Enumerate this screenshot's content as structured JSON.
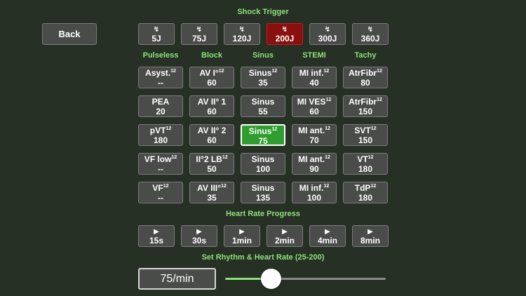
{
  "back_label": "Back",
  "shock": {
    "title": "Shock Trigger",
    "glyph": "↯",
    "buttons": [
      "5J",
      "75J",
      "120J",
      "200J",
      "300J",
      "360J"
    ],
    "active_index": 3
  },
  "columns": [
    "Pulseless",
    "Block",
    "Sinus",
    "STEMI",
    "Tachy"
  ],
  "rhythms": [
    [
      {
        "name": "Asyst.",
        "sup": "12",
        "rate": "--"
      },
      {
        "name": "PEA",
        "sup": "",
        "rate": "20"
      },
      {
        "name": "pVT",
        "sup": "12",
        "rate": "180"
      },
      {
        "name": "VF low",
        "sup": "12",
        "rate": "--"
      },
      {
        "name": "VF",
        "sup": "12",
        "rate": "--"
      }
    ],
    [
      {
        "name": "AV I°",
        "sup": "12",
        "rate": "60"
      },
      {
        "name": "AV II° 1",
        "sup": "",
        "rate": "60"
      },
      {
        "name": "AV II° 2",
        "sup": "",
        "rate": "60"
      },
      {
        "name": "II°2 LB",
        "sup": "12",
        "rate": "50"
      },
      {
        "name": "AV III°",
        "sup": "12",
        "rate": "35"
      }
    ],
    [
      {
        "name": "Sinus",
        "sup": "12",
        "rate": "35"
      },
      {
        "name": "Sinus",
        "sup": "",
        "rate": "55"
      },
      {
        "name": "Sinus",
        "sup": "12",
        "rate": "75"
      },
      {
        "name": "Sinus",
        "sup": "",
        "rate": "100"
      },
      {
        "name": "Sinus",
        "sup": "",
        "rate": "135"
      }
    ],
    [
      {
        "name": "MI inf.",
        "sup": "12",
        "rate": "40"
      },
      {
        "name": "MI VES",
        "sup": "12",
        "rate": "60"
      },
      {
        "name": "MI ant.",
        "sup": "12",
        "rate": "70"
      },
      {
        "name": "MI ant.",
        "sup": "12",
        "rate": "90"
      },
      {
        "name": "MI inf.",
        "sup": "12",
        "rate": "100"
      }
    ],
    [
      {
        "name": "AtrFibr",
        "sup": "12",
        "rate": "80"
      },
      {
        "name": "AtrFibr",
        "sup": "12",
        "rate": "150"
      },
      {
        "name": "SVT",
        "sup": "12",
        "rate": "150"
      },
      {
        "name": "VT",
        "sup": "12",
        "rate": "180"
      },
      {
        "name": "TdP",
        "sup": "12",
        "rate": "180"
      }
    ]
  ],
  "selected_rhythm": {
    "col": 2,
    "row": 2
  },
  "progress": {
    "title": "Heart Rate Progress",
    "glyph": "▶",
    "buttons": [
      "15s",
      "30s",
      "1min",
      "2min",
      "4min",
      "8min"
    ]
  },
  "rate": {
    "title": "Set Rhythm & Heart Rate (25-200)",
    "display": "75/min",
    "value": 75,
    "min": 25,
    "max": 200
  },
  "colors": {
    "background": "#263025",
    "accent_green": "#8fe07a",
    "shock_active": "#8a0f0f",
    "rhythm_active": "#2f9d2f"
  }
}
